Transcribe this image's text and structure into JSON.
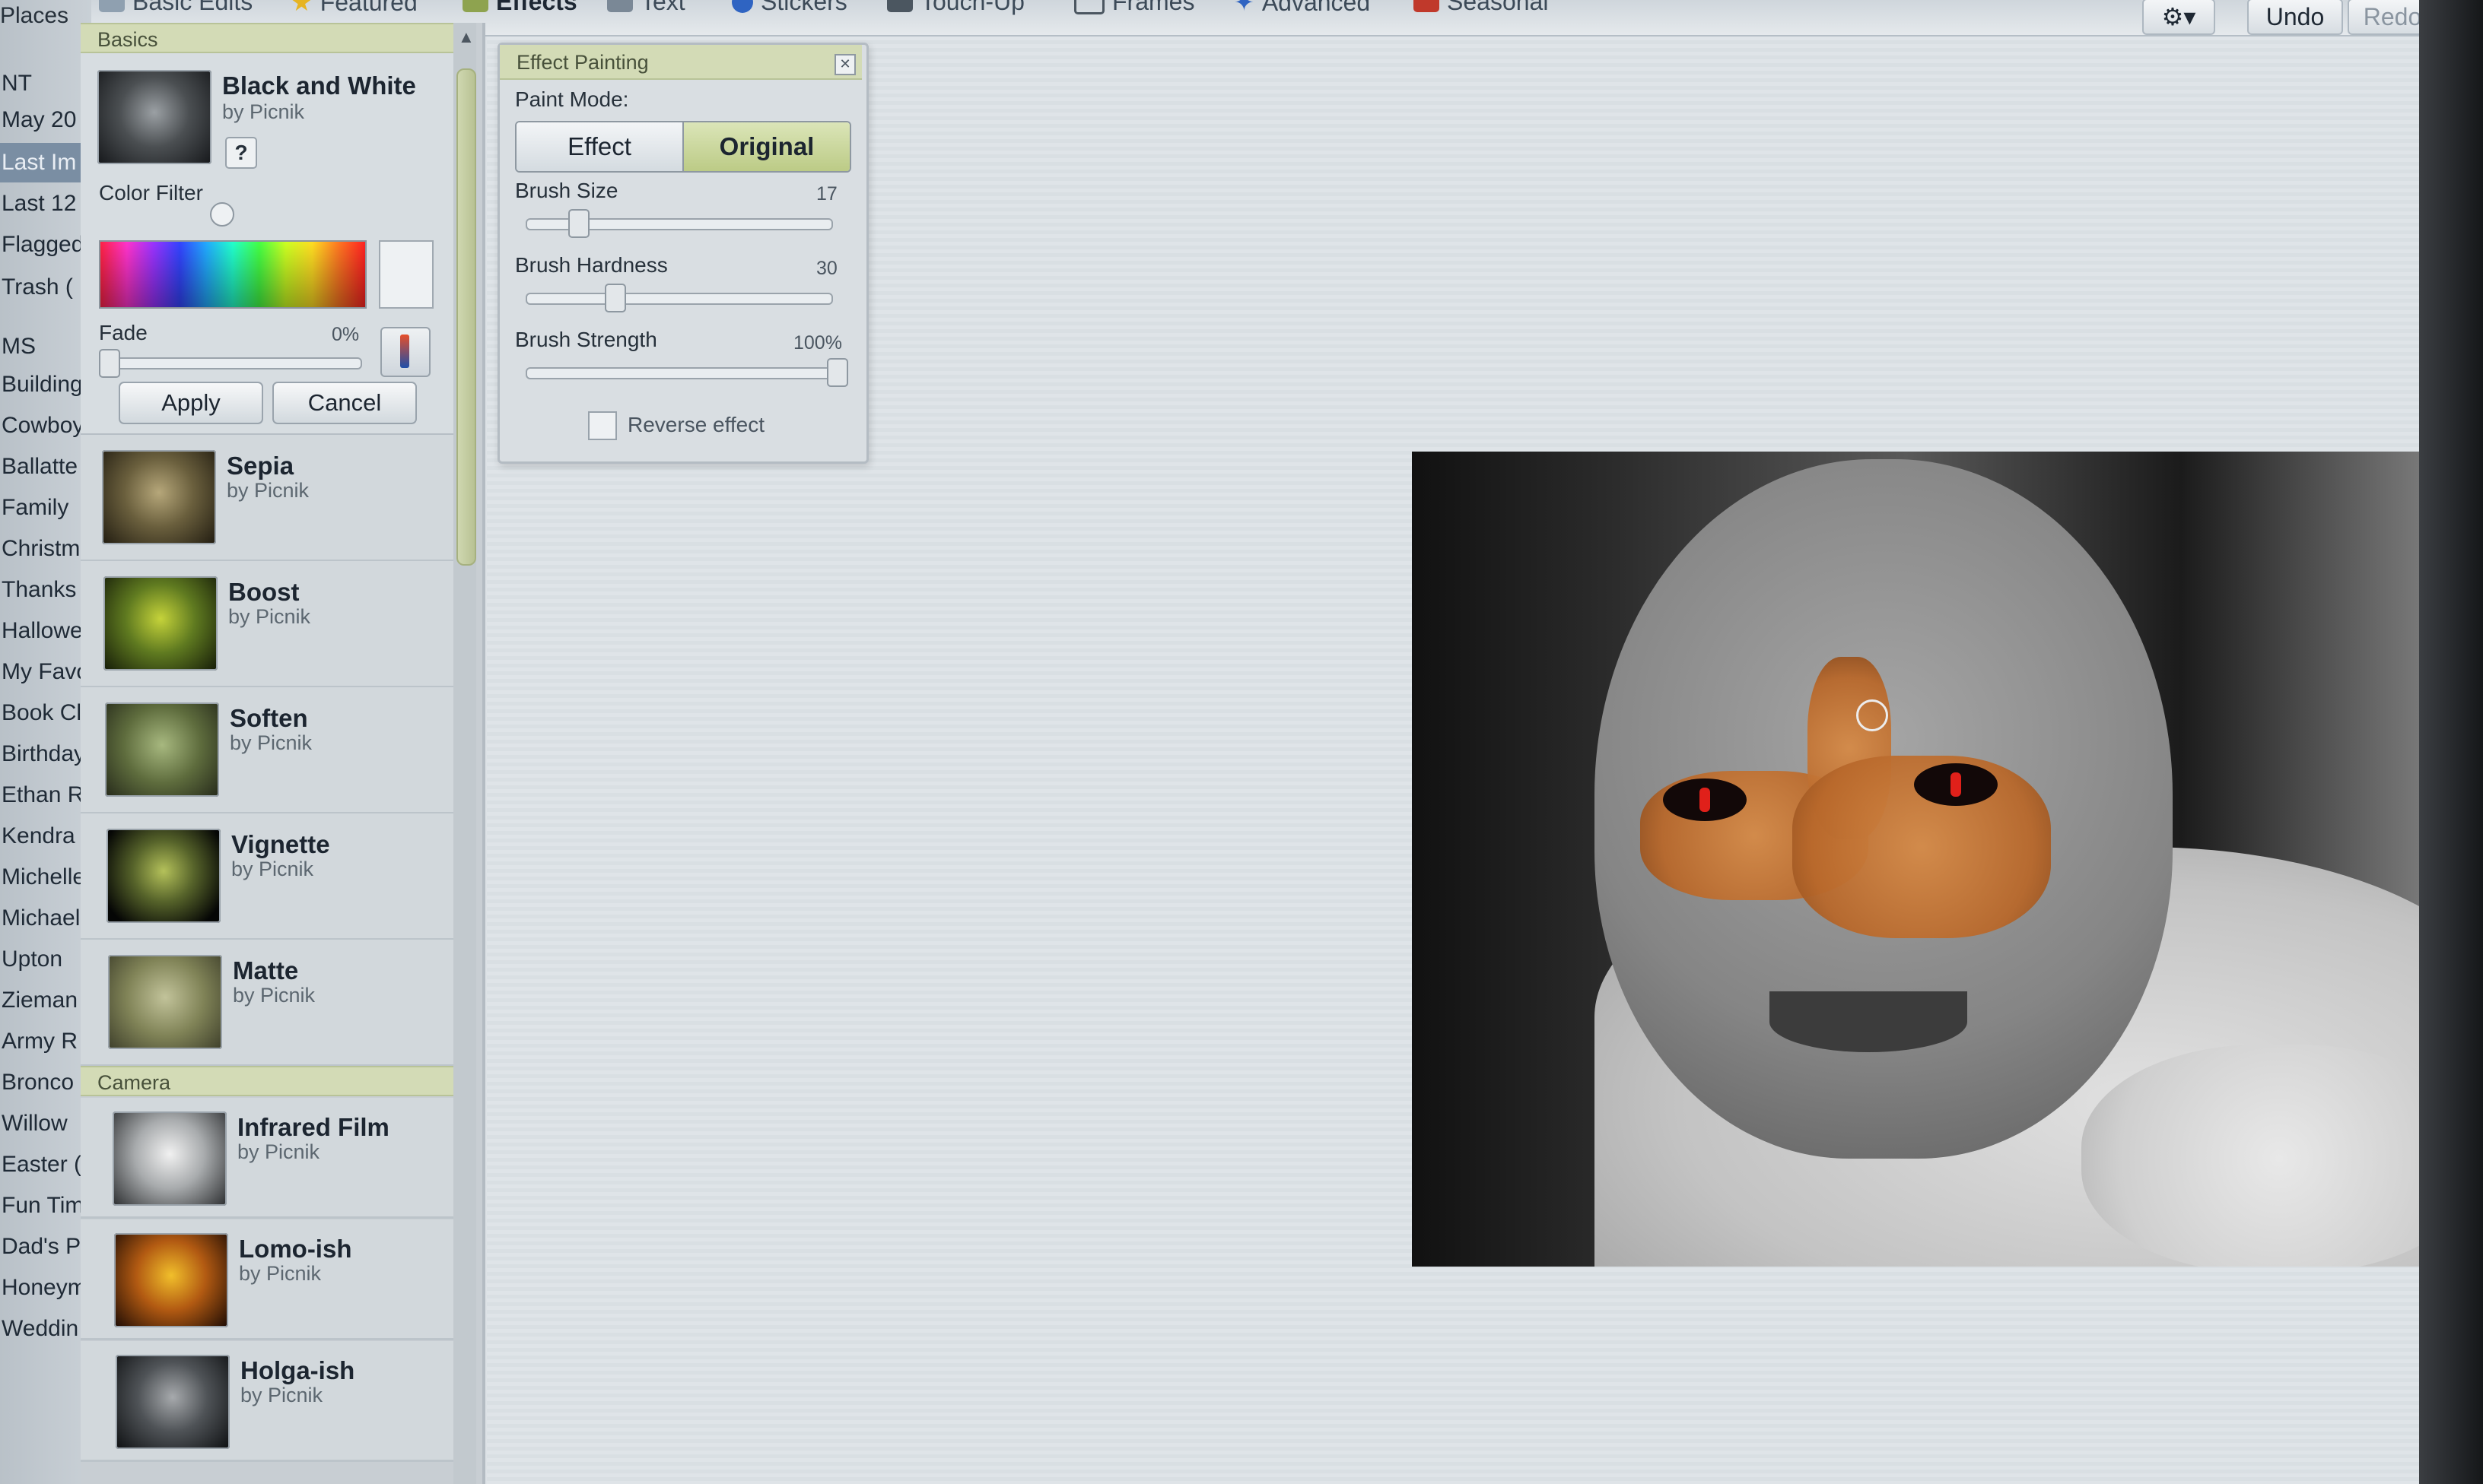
{
  "places": {
    "header": "Places",
    "items": [
      "NT",
      "May 20",
      "Last Im",
      "Last 12",
      "Flagged",
      "Trash (",
      "MS",
      "Building",
      "Cowboy",
      "Ballatte",
      "Family",
      "Christm",
      "Thanks",
      "Hallowe",
      "My Favo",
      "Book Cl",
      "Birthday",
      "Ethan R",
      "Kendra",
      "Michelle",
      "Michael",
      "Upton",
      "Zieman",
      "Army R",
      "Bronco",
      "Willow",
      "Easter (",
      "Fun Tim",
      "Dad's P",
      "Honeym",
      "Weddin"
    ],
    "selected_item": "Last Im"
  },
  "toolbar": {
    "tabs": [
      {
        "label": "Basic Edits",
        "icon": "basic-edits-icon"
      },
      {
        "label": "Featured",
        "icon": "star-icon"
      },
      {
        "label": "Effects",
        "icon": "effects-icon",
        "active": true
      },
      {
        "label": "Text",
        "icon": "text-icon"
      },
      {
        "label": "Stickers",
        "icon": "stickers-icon"
      },
      {
        "label": "Touch-Up",
        "icon": "touch-up-icon"
      },
      {
        "label": "Frames",
        "icon": "frames-icon"
      },
      {
        "label": "Advanced",
        "icon": "advanced-icon"
      },
      {
        "label": "Seasonal",
        "icon": "seasonal-icon"
      }
    ],
    "settings_icon": "gear-icon",
    "undo_label": "Undo",
    "redo_label": "Redo"
  },
  "effects_panel": {
    "basics_header": "Basics",
    "current_effect": {
      "title": "Black and White",
      "author": "by Picnik",
      "help_label": "?",
      "color_filter_label": "Color Filter",
      "fade_label": "Fade",
      "fade_value": "0%",
      "apply_label": "Apply",
      "cancel_label": "Cancel"
    },
    "basics_items": [
      {
        "title": "Sepia",
        "author": "by Picnik"
      },
      {
        "title": "Boost",
        "author": "by Picnik"
      },
      {
        "title": "Soften",
        "author": "by Picnik"
      },
      {
        "title": "Vignette",
        "author": "by Picnik"
      },
      {
        "title": "Matte",
        "author": "by Picnik"
      }
    ],
    "camera_header": "Camera",
    "camera_items": [
      {
        "title": "Infrared Film",
        "author": "by Picnik"
      },
      {
        "title": "Lomo-ish",
        "author": "by Picnik"
      },
      {
        "title": "Holga-ish",
        "author": "by Picnik"
      }
    ]
  },
  "effect_painting": {
    "title": "Effect Painting",
    "paint_mode_label": "Paint Mode:",
    "mode_effect": "Effect",
    "mode_original": "Original",
    "selected_mode": "Original",
    "brush_size_label": "Brush Size",
    "brush_size_value": "17",
    "brush_hardness_label": "Brush Hardness",
    "brush_hardness_value": "30",
    "brush_strength_label": "Brush Strength",
    "brush_strength_value": "100%",
    "reverse_effect_label": "Reverse effect",
    "reverse_effect_checked": false
  },
  "colors": {
    "section_header_bg": "#d3dbb6",
    "selected_mode_bg": "#bccb86",
    "paint_color": "#c77a3a"
  }
}
